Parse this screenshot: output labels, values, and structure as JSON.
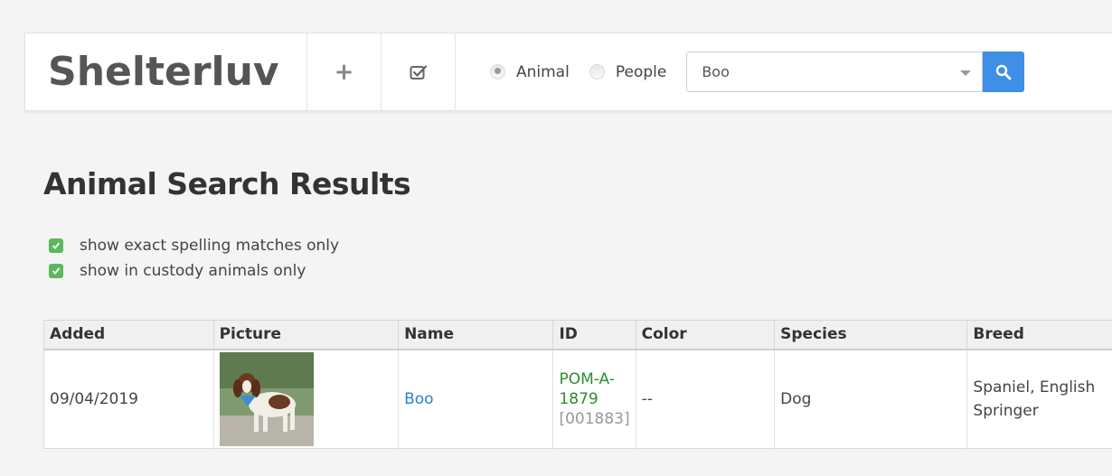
{
  "header": {
    "brand": "Shelterluv",
    "add_icon": "plus-icon",
    "tasks_icon": "checkbox-icon"
  },
  "search": {
    "radio_animal": "Animal",
    "radio_people": "People",
    "selected": "Animal",
    "query": "Boo",
    "button_icon": "search-icon",
    "button_color": "#3f8fe6"
  },
  "page": {
    "title": "Animal Search Results"
  },
  "filters": [
    {
      "label": "show exact spelling matches only",
      "checked": true
    },
    {
      "label": "show in custody animals only",
      "checked": true
    }
  ],
  "table": {
    "headers": [
      "Added",
      "Picture",
      "Name",
      "ID",
      "Color",
      "Species",
      "Breed"
    ],
    "rows": [
      {
        "added": "09/04/2019",
        "picture": "dog-photo",
        "name": "Boo",
        "id_line1": "POM-A-",
        "id_line2": "1879",
        "id_sub": "[001883]",
        "color": "--",
        "species": "Dog",
        "breed": "Spaniel, English Springer"
      }
    ]
  },
  "colors": {
    "link_blue": "#2a7fd4",
    "id_green": "#2e8b2e",
    "checkbox_green": "#5cb85c"
  }
}
